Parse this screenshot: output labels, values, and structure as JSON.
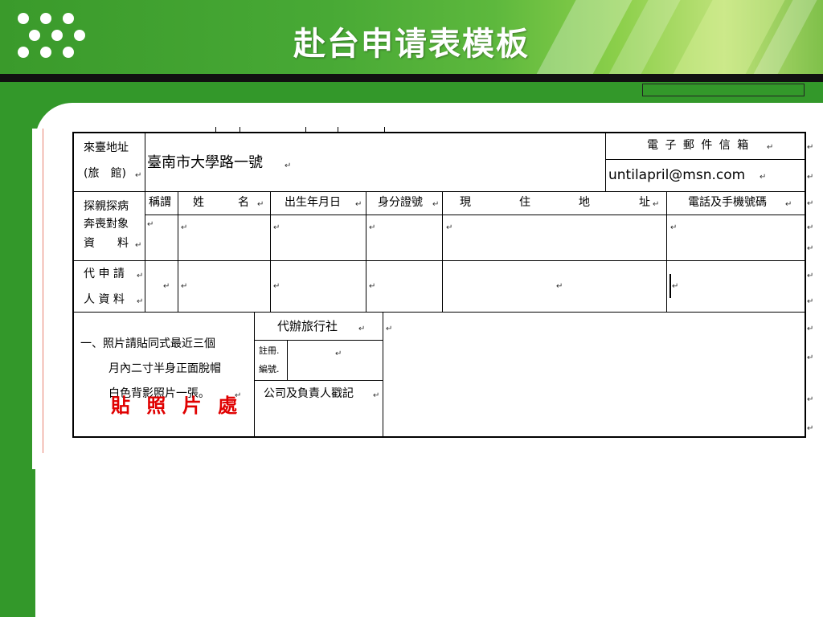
{
  "slide": {
    "title": "赴台申请表模板",
    "colors": {
      "green": "#33982a",
      "header_green": "#48a935",
      "stamp_red": "#e00000",
      "black_band": "#111111"
    }
  },
  "form": {
    "return_mark": "↵",
    "row_address": {
      "label_1": "來臺地址",
      "label_2": "(旅　館)",
      "value": "臺南市大學路一號",
      "email_label": "電 子 郵 件 信 箱",
      "email_value": "untilapril@msn.com"
    },
    "headers": {
      "title": "稱謂",
      "name": "姓　　　名",
      "birth": "出生年月日",
      "id_no": "身分證號",
      "addr_1": "現",
      "addr_2": "住",
      "addr_3": "地",
      "addr_4": "址",
      "phone": "電話及手機號碼"
    },
    "section_visit": {
      "line_1": "探親探病",
      "line_2": "奔喪對象",
      "line_3": "資　　料"
    },
    "section_agent": {
      "line_1": "代 申 請",
      "line_2": "人 資 料"
    },
    "photo": {
      "line_1": "一、照片請貼同式最近三個",
      "line_2": "月內二寸半身正面脫帽",
      "line_3": "白色背影照片一張。",
      "stamp": "貼 照 片 處"
    },
    "agency": {
      "title": "代辦旅行社",
      "reg_1": "註冊.",
      "reg_2": "編號.",
      "seal": "公司及負責人戳記"
    }
  }
}
